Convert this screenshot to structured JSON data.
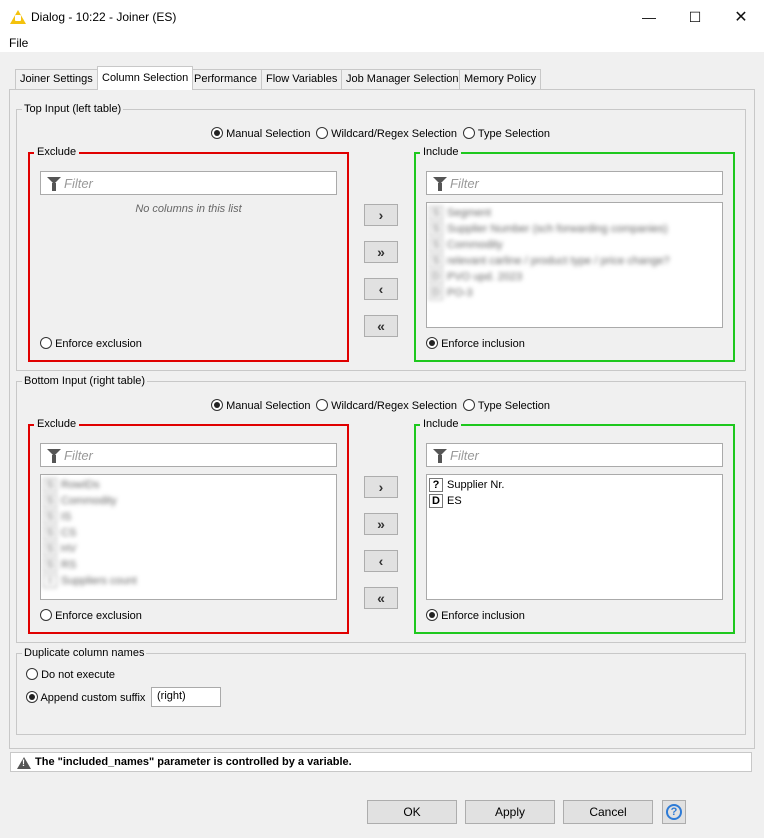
{
  "window": {
    "title": "Dialog - 10:22 - Joiner (ES)",
    "min_icon": "minimize-icon",
    "max_icon": "maximize-icon",
    "close_icon": "close-icon"
  },
  "menu": {
    "file": "File"
  },
  "tabs": [
    {
      "label": "Joiner Settings"
    },
    {
      "label": "Column Selection"
    },
    {
      "label": "Performance"
    },
    {
      "label": "Flow Variables"
    },
    {
      "label": "Job Manager Selection"
    },
    {
      "label": "Memory Policy"
    }
  ],
  "active_tab": "Column Selection",
  "top_input": {
    "title": "Top Input (left table)",
    "modes": [
      "Manual Selection",
      "Wildcard/Regex Selection",
      "Type Selection"
    ],
    "selected_mode": "Manual Selection",
    "exclude": {
      "label": "Exclude",
      "filter_placeholder": "Filter",
      "empty_message": "No columns in this list",
      "enforce_label": "Enforce exclusion",
      "enforce_selected": false
    },
    "include": {
      "label": "Include",
      "filter_placeholder": "Filter",
      "items": [
        {
          "type": "S",
          "name": "Segment"
        },
        {
          "type": "S",
          "name": "Supplier Number (sch forwarding companies)"
        },
        {
          "type": "S",
          "name": "Commodity"
        },
        {
          "type": "S",
          "name": "relevant carline / product type / price change?"
        },
        {
          "type": "D",
          "name": "PVO upd. 2023"
        },
        {
          "type": "D",
          "name": "PO-3"
        }
      ],
      "enforce_label": "Enforce inclusion",
      "enforce_selected": true
    }
  },
  "bottom_input": {
    "title": "Bottom Input (right table)",
    "modes": [
      "Manual Selection",
      "Wildcard/Regex Selection",
      "Type Selection"
    ],
    "selected_mode": "Manual Selection",
    "exclude": {
      "label": "Exclude",
      "filter_placeholder": "Filter",
      "items": [
        {
          "type": "S",
          "name": "RowIDs"
        },
        {
          "type": "S",
          "name": "Commodity"
        },
        {
          "type": "S",
          "name": "IS"
        },
        {
          "type": "S",
          "name": "CS"
        },
        {
          "type": "S",
          "name": "HV"
        },
        {
          "type": "S",
          "name": "RS"
        },
        {
          "type": "I",
          "name": "Suppliers count"
        }
      ],
      "enforce_label": "Enforce exclusion",
      "enforce_selected": false
    },
    "include": {
      "label": "Include",
      "filter_placeholder": "Filter",
      "items": [
        {
          "type": "?",
          "name": "Supplier Nr."
        },
        {
          "type": "D",
          "name": "ES"
        }
      ],
      "enforce_label": "Enforce inclusion",
      "enforce_selected": true
    }
  },
  "move_buttons": {
    "add": "›",
    "add_all": "»",
    "remove": "‹",
    "remove_all": "«"
  },
  "duplicates": {
    "title": "Duplicate column names",
    "option_not_execute": "Do not execute",
    "option_suffix": "Append custom suffix",
    "selected": "suffix",
    "suffix_value": "(right)"
  },
  "status": {
    "icon": "warning-icon",
    "message": "The \"included_names\" parameter is controlled by a variable."
  },
  "buttons": {
    "ok": "OK",
    "apply": "Apply",
    "cancel": "Cancel",
    "help": "?"
  },
  "colors": {
    "exclude_border": "#e00000",
    "include_border": "#1ec81e",
    "help_accent": "#2e7bd6"
  }
}
